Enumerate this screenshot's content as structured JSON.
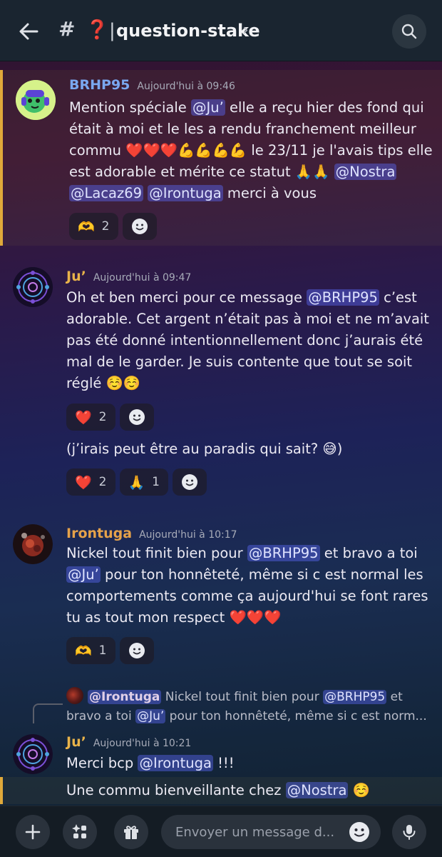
{
  "header": {
    "channel_prefix": "#",
    "channel_emoji": "❓",
    "separator": "|",
    "channel_name": "question-stake",
    "chevron": "›"
  },
  "messages": [
    {
      "author": "BRHP95",
      "author_color": "#7aa8f0",
      "time": "Aujourd'hui à 09:46",
      "text_parts": [
        "Mention spéciale ",
        "@Ju’",
        " elle a reçu hier des fond qui était à moi et le les a rendu franchement meilleur commu ❤️❤️❤️💪💪💪💪 le 23/11 je l'avais tips elle est adorable et mérite ce statut 🙏🙏 ",
        "@Nostra",
        " ",
        "@Lacaz69",
        " ",
        "@Irontuga",
        " merci à vous"
      ],
      "reactions": [
        {
          "emoji": "🫶",
          "count": "2"
        }
      ]
    },
    {
      "author": "Ju’",
      "author_color": "#e9b34a",
      "time": "Aujourd'hui à 09:47",
      "text_parts": [
        "Oh et ben merci pour ce message ",
        "@BRHP95",
        " c’est adorable. Cet argent n’était pas à moi et ne m’avait pas été donné intentionnellement donc j’aurais été mal de le garder. Je suis contente que tout se soit réglé ☺️☺️"
      ],
      "reactions": [
        {
          "emoji": "❤️",
          "count": "2"
        }
      ],
      "followup": "(j’irais peut être au paradis qui sait? 😅)",
      "followup_reactions": [
        {
          "emoji": "❤️",
          "count": "2"
        },
        {
          "emoji": "🙏",
          "count": "1"
        }
      ]
    },
    {
      "author": "Irontuga",
      "author_color": "#e6a24a",
      "time": "Aujourd'hui à 10:17",
      "text_parts": [
        "Nickel tout finit bien pour ",
        "@BRHP95",
        "  et bravo a toi ",
        "@Ju’",
        " pour ton honnêteté, même si c est normal les comportements comme ça aujourd'hui se font rares tu as tout mon respect ❤️❤️❤️"
      ],
      "reactions": [
        {
          "emoji": "🫶",
          "count": "1"
        }
      ]
    },
    {
      "reply_author": "@Irontuga",
      "reply_text_parts": [
        " Nickel tout finit bien pour ",
        "@BRHP95",
        " et bravo a toi ",
        "@Ju’",
        " pour ton honnêteté, même si c est norm..."
      ],
      "author": "Ju’",
      "author_color": "#e9b34a",
      "time": "Aujourd'hui à 10:21",
      "line1_parts": [
        "Merci bcp ",
        "@Irontuga",
        " !!!"
      ],
      "line2_parts": [
        "Une commu bienveillante chez ",
        "@Nostra",
        " ☺️"
      ]
    }
  ],
  "composer": {
    "placeholder": "Envoyer un message d..."
  },
  "icons": {
    "back": "arrow-left",
    "search": "magnifier",
    "add_reaction": "smiley",
    "plus": "plus",
    "apps": "sparkle-grid",
    "gift": "gift",
    "mic": "microphone"
  }
}
